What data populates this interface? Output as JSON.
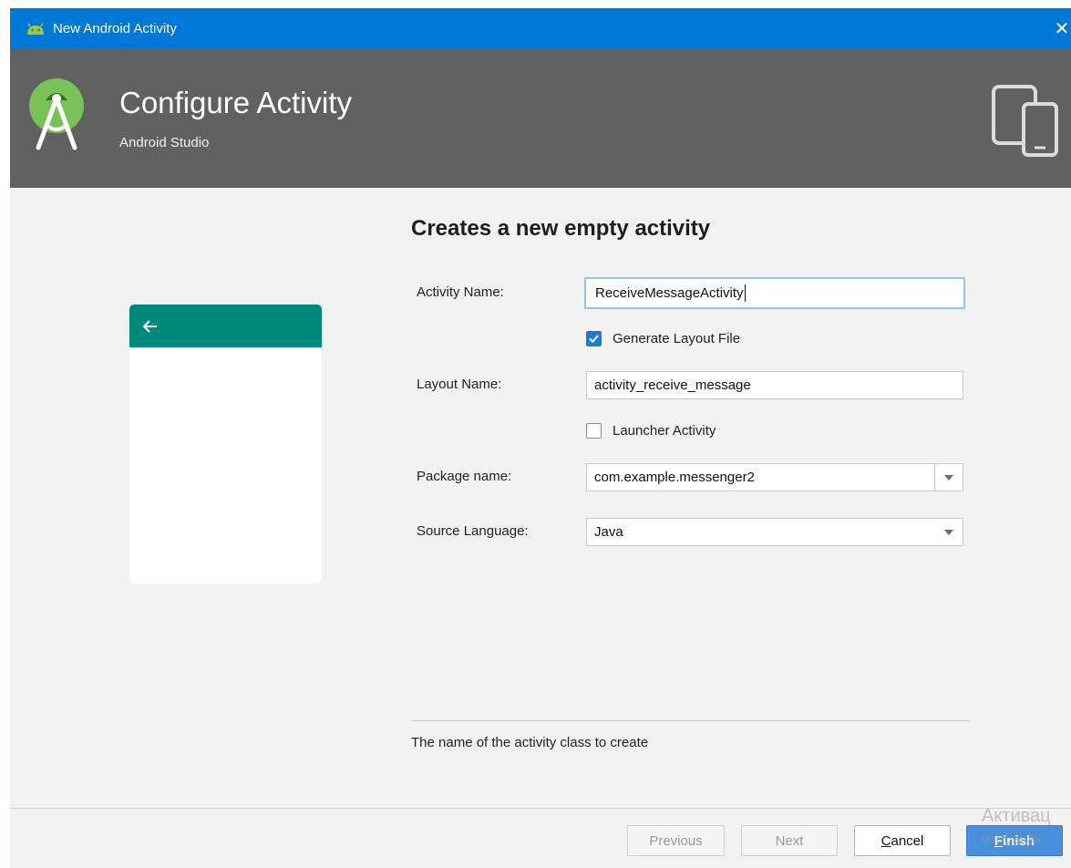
{
  "window": {
    "title": "New Android Activity",
    "close_glyph": "✕"
  },
  "header": {
    "title": "Configure Activity",
    "subtitle": "Android Studio",
    "logo_icon": "android-studio-logo-icon",
    "devices_icon": "devices-icon"
  },
  "preview": {
    "appbar_color": "#00897b",
    "back_icon": "arrow-left-icon"
  },
  "form": {
    "title": "Creates a new empty activity",
    "activity_name_label": "Activity Name:",
    "activity_name_value": "ReceiveMessageActivity",
    "generate_layout_label": "Generate Layout File",
    "generate_layout_checked": true,
    "layout_name_label": "Layout Name:",
    "layout_name_value": "activity_receive_message",
    "launcher_label": "Launcher Activity",
    "launcher_checked": false,
    "package_label": "Package name:",
    "package_value": "com.example.messenger2",
    "language_label": "Source Language:",
    "language_value": "Java"
  },
  "hint": "The name of the activity class to create",
  "footer": {
    "previous_label": "Previous",
    "next_label": "Next",
    "cancel_label": "Cancel",
    "cancel_mnemonic": "C",
    "cancel_rest": "ancel",
    "finish_label": "Finish",
    "finish_mnemonic": "F",
    "finish_rest": "inish"
  },
  "watermark": {
    "line1": "Активац",
    "line2": "чтобы ак"
  },
  "colors": {
    "titlebar": "#0078d7",
    "header": "#616161",
    "accent": "#1e7ad7",
    "finish_button": "#4a8fdb"
  }
}
